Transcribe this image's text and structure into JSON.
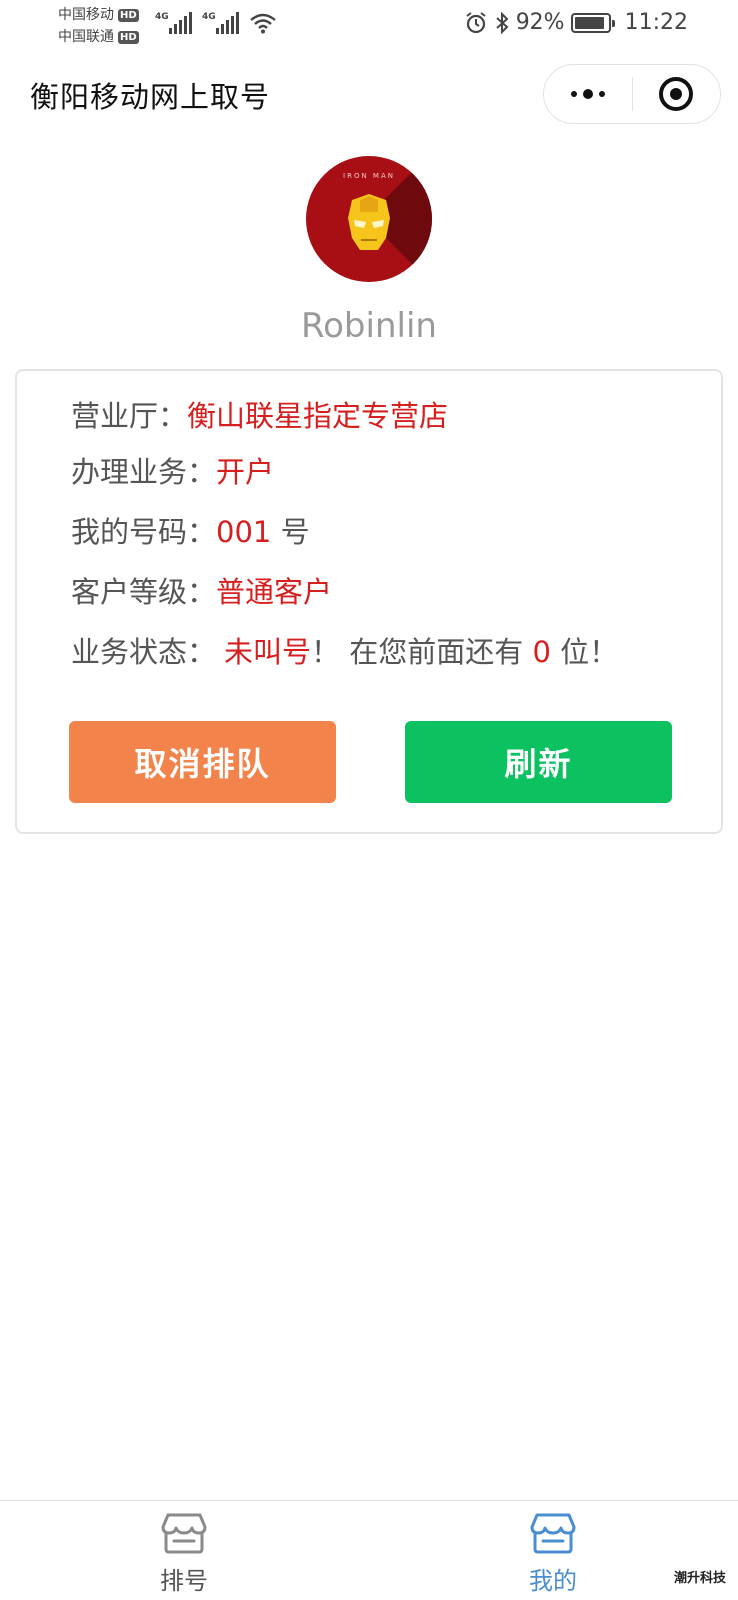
{
  "status_bar": {
    "carrier1": "中国移动",
    "carrier2": "中国联通",
    "hd_badge": "HD",
    "network": "4G",
    "battery": "92%",
    "battery_level": 0.92,
    "time": "11:22"
  },
  "nav": {
    "title": "衡阳移动网上取号"
  },
  "avatar": {
    "logo_text": "IRON MAN"
  },
  "user": {
    "name": "Robinlin"
  },
  "card": {
    "hall_label": "营业厅：",
    "hall_value": "衡山联星指定专营店",
    "service_label": "办理业务：",
    "service_value": "开户",
    "number_label": "我的号码：",
    "number_value": "001",
    "number_suffix": " 号",
    "level_label": "客户等级：",
    "level_value": "普通客户",
    "status_label": "业务状态：",
    "status_value": "未叫号",
    "status_excl": "！ ",
    "ahead_prefix": "在您前面还有 ",
    "ahead_count": "0",
    "ahead_suffix": " 位！",
    "cancel_button": "取消排队",
    "refresh_button": "刷新"
  },
  "tabbar": {
    "tabs": [
      {
        "label": "排号",
        "icon": "store-icon",
        "active": false
      },
      {
        "label": "我的",
        "icon": "store-icon",
        "active": true
      }
    ],
    "inactive_color": "#555555",
    "active_color": "#4a8ed0"
  },
  "watermark": "潮升科技",
  "colors": {
    "highlight_red": "#d61f1f",
    "cancel_orange": "#f2844b",
    "refresh_green": "#0cc160",
    "avatar_red": "#a70f14"
  }
}
